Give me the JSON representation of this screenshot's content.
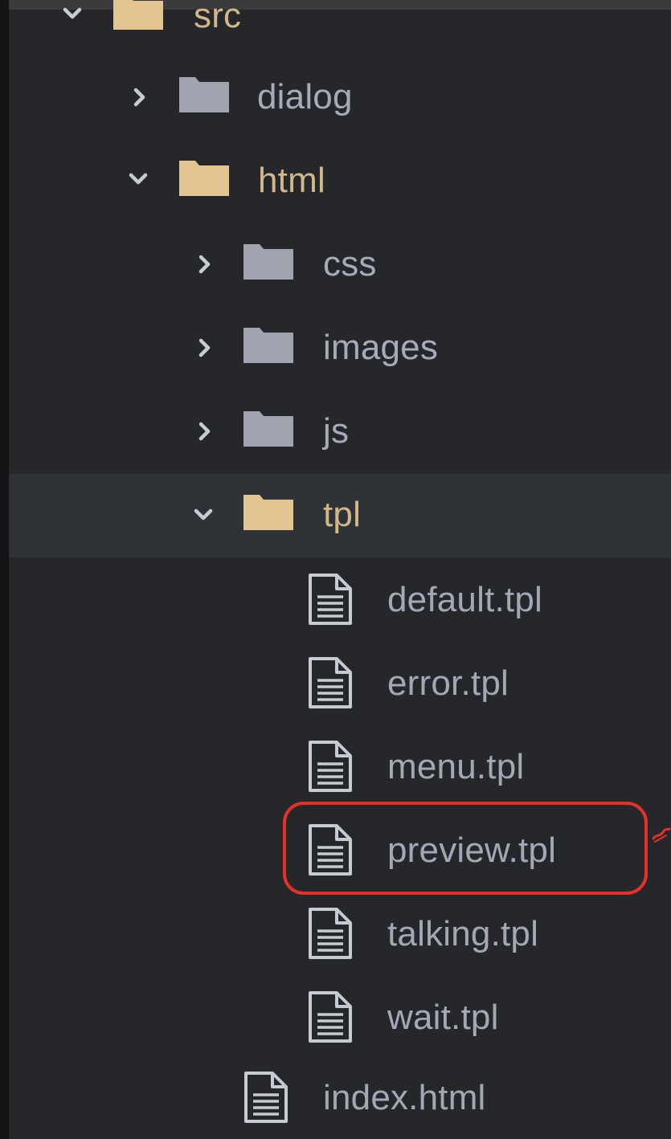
{
  "tree": {
    "items": [
      {
        "label": "src",
        "kind": "folder",
        "expanded": true
      },
      {
        "label": "dialog",
        "kind": "folder",
        "expanded": false
      },
      {
        "label": "html",
        "kind": "folder",
        "expanded": true
      },
      {
        "label": "css",
        "kind": "folder",
        "expanded": false
      },
      {
        "label": "images",
        "kind": "folder",
        "expanded": false
      },
      {
        "label": "js",
        "kind": "folder",
        "expanded": false
      },
      {
        "label": "tpl",
        "kind": "folder",
        "expanded": true,
        "selected": true
      },
      {
        "label": "default.tpl",
        "kind": "file"
      },
      {
        "label": "error.tpl",
        "kind": "file"
      },
      {
        "label": "menu.tpl",
        "kind": "file"
      },
      {
        "label": "preview.tpl",
        "kind": "file",
        "highlighted": true
      },
      {
        "label": "talking.tpl",
        "kind": "file"
      },
      {
        "label": "wait.tpl",
        "kind": "file"
      },
      {
        "label": "index.html",
        "kind": "file"
      }
    ]
  },
  "colors": {
    "background": "#25272b",
    "selected_row": "#2f3237",
    "folder_open": "#e3c591",
    "folder_closed": "#9fa4ae",
    "text": "#a6acb7",
    "highlight": "#e4322b"
  },
  "icons": {
    "chevron_right": "chevron-right-icon",
    "chevron_down": "chevron-down-icon",
    "folder_open": "folder-open-icon",
    "folder_closed": "folder-icon",
    "file": "file-text-icon"
  }
}
